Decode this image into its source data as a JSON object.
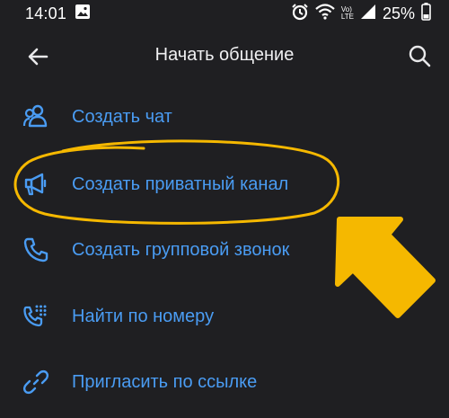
{
  "status_bar": {
    "time": "14:01",
    "battery_percent": "25%",
    "signal_badge_top": "Vo)",
    "signal_badge_bottom": "LTE"
  },
  "app_bar": {
    "title": "Начать общение",
    "back_icon": "arrow-left-icon",
    "search_icon": "search-icon"
  },
  "menu": {
    "items": [
      {
        "label": "Создать чат",
        "icon": "users-icon"
      },
      {
        "label": "Создать приватный канал",
        "icon": "megaphone-icon"
      },
      {
        "label": "Создать групповой звонок",
        "icon": "phone-icon"
      },
      {
        "label": "Найти по номеру",
        "icon": "dialpad-phone-icon"
      },
      {
        "label": "Пригласить по ссылке",
        "icon": "link-icon"
      }
    ]
  },
  "colors": {
    "background": "#1f1f22",
    "accent": "#4a9cf3",
    "annotation": "#f5b800"
  }
}
